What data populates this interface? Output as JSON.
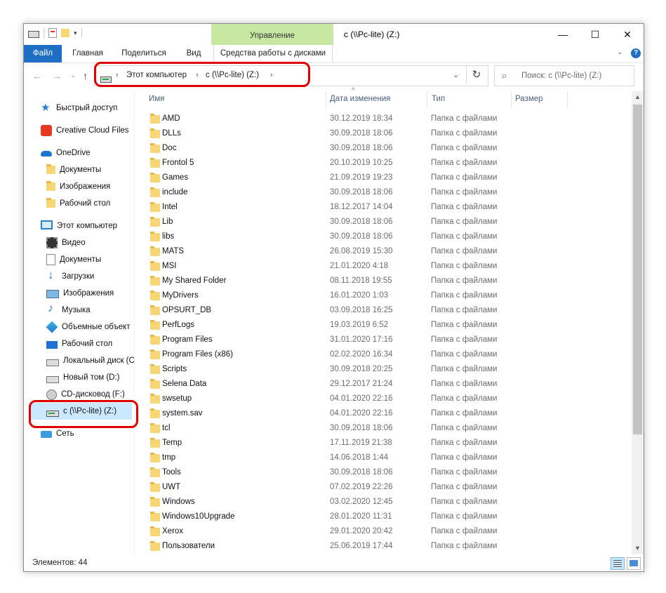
{
  "window": {
    "title": "c (\\\\Pc-lite) (Z:)",
    "contextual_tab": "Управление",
    "controls": {
      "minimize": "—",
      "maximize": "☐",
      "close": "✕"
    }
  },
  "ribbon": {
    "tabs": [
      {
        "label": "Файл",
        "active": true
      },
      {
        "label": "Главная"
      },
      {
        "label": "Поделиться"
      },
      {
        "label": "Вид"
      },
      {
        "label": "Средства работы с дисками"
      }
    ],
    "help": "?",
    "collapse": "⌄"
  },
  "nav": {
    "back": "←",
    "forward": "→",
    "recent": "⌄",
    "up": "↑"
  },
  "address": {
    "crumbs": [
      "Этот компьютер",
      "c (\\\\Pc-lite) (Z:)"
    ],
    "separator": "›",
    "dropdown": "⌄",
    "refresh": "↻"
  },
  "search": {
    "placeholder": "Поиск: c (\\\\Pc-lite) (Z:)",
    "icon": "⌕"
  },
  "sidebar": [
    {
      "label": "Быстрый доступ",
      "icon": "star-icon"
    },
    {
      "label": "Creative Cloud Files",
      "icon": "creative-cloud-icon"
    },
    {
      "label": "OneDrive",
      "icon": "cloud-icon"
    },
    {
      "label": "Документы",
      "icon": "folder-icon"
    },
    {
      "label": "Изображения",
      "icon": "folder-icon"
    },
    {
      "label": "Рабочий стол",
      "icon": "folder-icon"
    },
    {
      "label": "Этот компьютер",
      "icon": "computer-icon"
    },
    {
      "label": "Видео",
      "icon": "video-icon"
    },
    {
      "label": "Документы",
      "icon": "document-icon"
    },
    {
      "label": "Загрузки",
      "icon": "download-icon"
    },
    {
      "label": "Изображения",
      "icon": "image-icon"
    },
    {
      "label": "Музыка",
      "icon": "music-icon"
    },
    {
      "label": "Объемные объект",
      "icon": "3d-objects-icon"
    },
    {
      "label": "Рабочий стол",
      "icon": "desktop-icon"
    },
    {
      "label": "Локальный диск (C",
      "icon": "local-disk-icon"
    },
    {
      "label": "Новый том (D:)",
      "icon": "disk-icon"
    },
    {
      "label": "CD-дисковод (F:)",
      "icon": "cd-drive-icon"
    },
    {
      "label": "c (\\\\Pc-lite) (Z:)",
      "icon": "network-drive-icon",
      "selected": true
    },
    {
      "label": "Сеть",
      "icon": "network-icon"
    }
  ],
  "columns": {
    "name": "Имя",
    "date": "Дата изменения",
    "type": "Тип",
    "size": "Размер",
    "sort": "^"
  },
  "files": [
    {
      "name": "AMD",
      "date": "30.12.2019 18:34",
      "type": "Папка с файлами"
    },
    {
      "name": "DLLs",
      "date": "30.09.2018 18:06",
      "type": "Папка с файлами"
    },
    {
      "name": "Doc",
      "date": "30.09.2018 18:06",
      "type": "Папка с файлами"
    },
    {
      "name": "Frontol 5",
      "date": "20.10.2019 10:25",
      "type": "Папка с файлами"
    },
    {
      "name": "Games",
      "date": "21.09.2019 19:23",
      "type": "Папка с файлами"
    },
    {
      "name": "include",
      "date": "30.09.2018 18:06",
      "type": "Папка с файлами"
    },
    {
      "name": "Intel",
      "date": "18.12.2017 14:04",
      "type": "Папка с файлами"
    },
    {
      "name": "Lib",
      "date": "30.09.2018 18:06",
      "type": "Папка с файлами"
    },
    {
      "name": "libs",
      "date": "30.09.2018 18:06",
      "type": "Папка с файлами"
    },
    {
      "name": "MATS",
      "date": "26.08.2019 15:30",
      "type": "Папка с файлами"
    },
    {
      "name": "MSI",
      "date": "21.01.2020 4:18",
      "type": "Папка с файлами"
    },
    {
      "name": "My Shared Folder",
      "date": "08.11.2018 19:55",
      "type": "Папка с файлами"
    },
    {
      "name": "MyDrivers",
      "date": "16.01.2020 1:03",
      "type": "Папка с файлами"
    },
    {
      "name": "OPSURT_DB",
      "date": "03.09.2018 16:25",
      "type": "Папка с файлами"
    },
    {
      "name": "PerfLogs",
      "date": "19.03.2019 6:52",
      "type": "Папка с файлами"
    },
    {
      "name": "Program Files",
      "date": "31.01.2020 17:16",
      "type": "Папка с файлами"
    },
    {
      "name": "Program Files (x86)",
      "date": "02.02.2020 16:34",
      "type": "Папка с файлами"
    },
    {
      "name": "Scripts",
      "date": "30.09.2018 20:25",
      "type": "Папка с файлами"
    },
    {
      "name": "Selena Data",
      "date": "29.12.2017 21:24",
      "type": "Папка с файлами"
    },
    {
      "name": "swsetup",
      "date": "04.01.2020 22:16",
      "type": "Папка с файлами"
    },
    {
      "name": "system.sav",
      "date": "04.01.2020 22:16",
      "type": "Папка с файлами"
    },
    {
      "name": "tcl",
      "date": "30.09.2018 18:06",
      "type": "Папка с файлами"
    },
    {
      "name": "Temp",
      "date": "17.11.2019 21:38",
      "type": "Папка с файлами"
    },
    {
      "name": "tmp",
      "date": "14.06.2018 1:44",
      "type": "Папка с файлами"
    },
    {
      "name": "Tools",
      "date": "30.09.2018 18:06",
      "type": "Папка с файлами"
    },
    {
      "name": "UWT",
      "date": "07.02.2019 22:26",
      "type": "Папка с файлами"
    },
    {
      "name": "Windows",
      "date": "03.02.2020 12:45",
      "type": "Папка с файлами"
    },
    {
      "name": "Windows10Upgrade",
      "date": "28.01.2020 11:31",
      "type": "Папка с файлами"
    },
    {
      "name": "Xerox",
      "date": "29.01.2020 20:42",
      "type": "Папка с файлами"
    },
    {
      "name": "Пользователи",
      "date": "25.06.2019 17:44",
      "type": "Папка с файлами"
    }
  ],
  "status": {
    "count": "Элементов: 44"
  },
  "scroll": {
    "up": "▲",
    "down": "▼"
  },
  "colors": {
    "accent": "#1e6fc4",
    "manage_tab": "#c7e8a2",
    "highlight": "#e00000",
    "selected": "#cce8ff"
  }
}
